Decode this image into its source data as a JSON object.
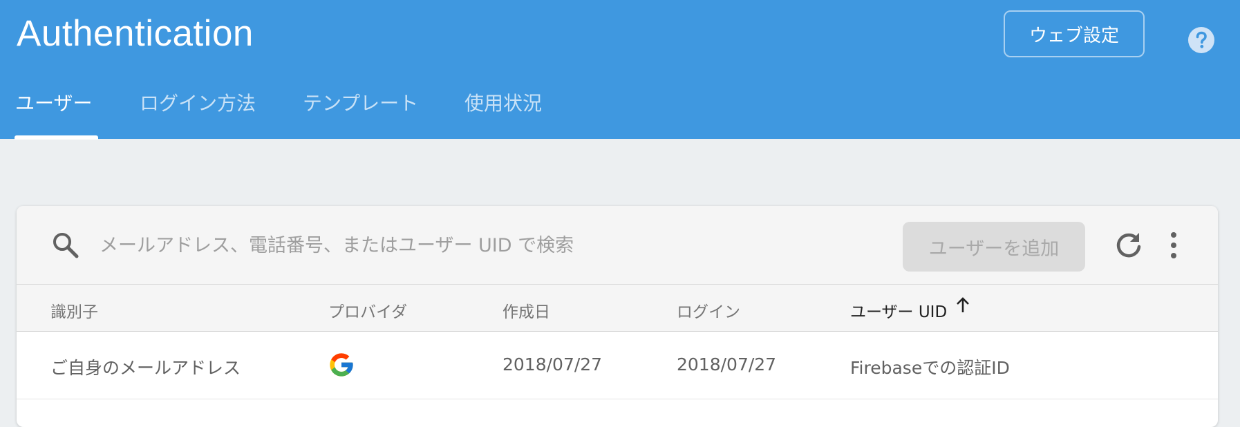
{
  "header": {
    "title": "Authentication",
    "web_settings_label": "ウェブ設定",
    "help_icon": "help-circle-icon",
    "background": "#3f98e0"
  },
  "tabs": [
    {
      "label": "ユーザー",
      "active": true
    },
    {
      "label": "ログイン方法",
      "active": false
    },
    {
      "label": "テンプレート",
      "active": false
    },
    {
      "label": "使用状況",
      "active": false
    }
  ],
  "toolbar": {
    "search_placeholder": "メールアドレス、電話番号、またはユーザー UID で検索",
    "add_user_label": "ユーザーを追加",
    "icons": [
      "search-icon",
      "refresh-icon",
      "more-vert-icon"
    ]
  },
  "table": {
    "columns": [
      "識別子",
      "プロバイダ",
      "作成日",
      "ログイン",
      "ユーザー UID"
    ],
    "sorted_column": "ユーザー UID",
    "sort_direction": "ascending",
    "rows": [
      {
        "identifier": "ご自身のメールアドレス",
        "provider": "google-icon",
        "created": "2018/07/27",
        "signed_in": "2018/07/27",
        "uid": "Firebaseでの認証ID"
      }
    ]
  }
}
